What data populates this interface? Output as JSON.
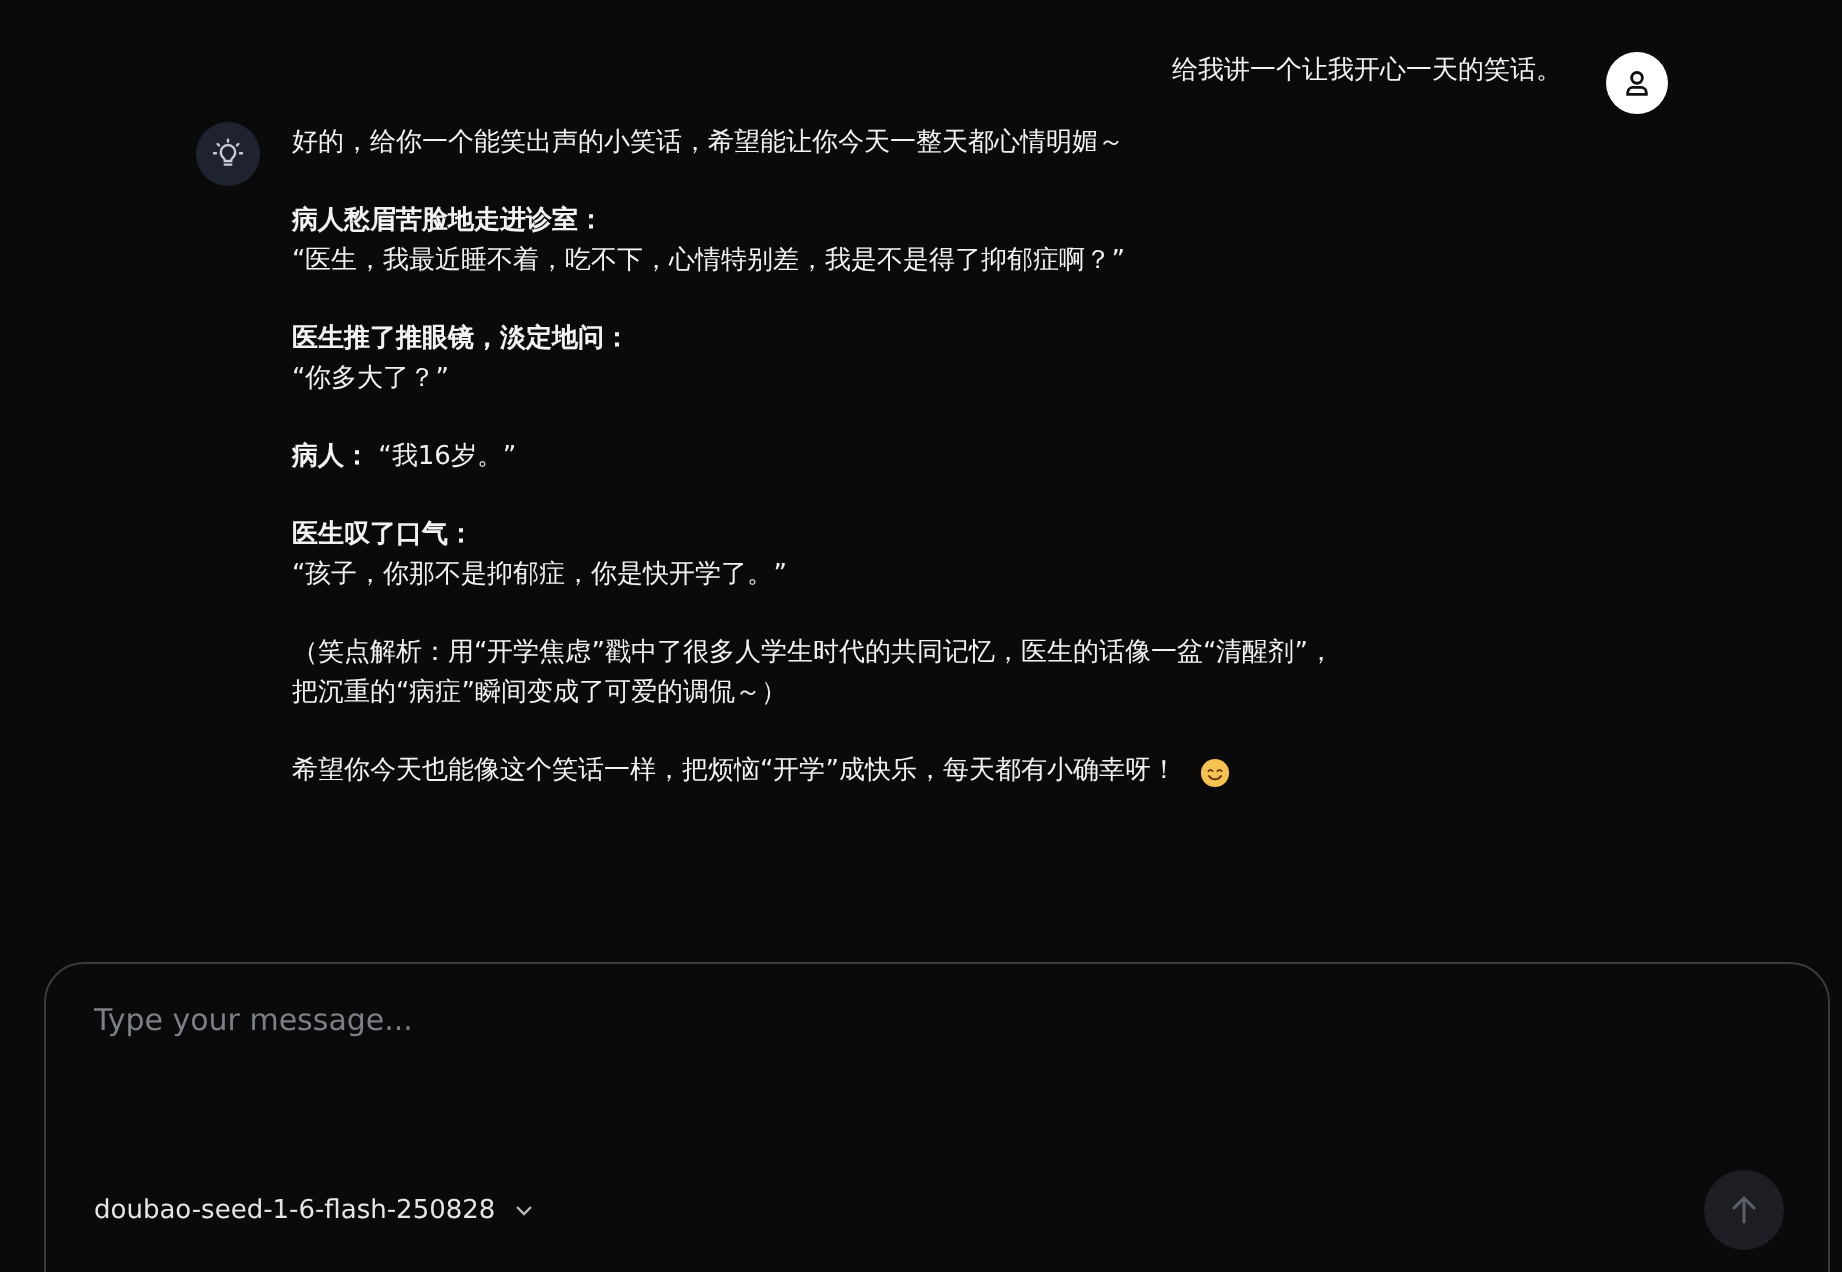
{
  "user_message": {
    "text": "给我讲一个让我开心一天的笑话。"
  },
  "assistant_message": {
    "paragraphs": [
      {
        "lines": [
          {
            "text": "好的，给你一个能笑出声的小笑话，希望能让你今天一整天都心情明媚～",
            "bold": false
          }
        ]
      },
      {
        "lines": [
          {
            "text": "病人愁眉苦脸地走进诊室：",
            "bold": true
          },
          {
            "text": "“医生，我最近睡不着，吃不下，心情特别差，我是不是得了抑郁症啊？”",
            "bold": false
          }
        ]
      },
      {
        "lines": [
          {
            "text": "医生推了推眼镜，淡定地问：",
            "bold": true
          },
          {
            "text": "“你多大了？”",
            "bold": false
          }
        ]
      },
      {
        "lines": [
          {
            "text": "**病人：** “我16岁。”",
            "bold": false
          }
        ]
      },
      {
        "lines": [
          {
            "text": "医生叹了口气：",
            "bold": true
          },
          {
            "text": "“孩子，你那不是抑郁症，你是快开学了。”",
            "bold": false
          }
        ]
      },
      {
        "lines": [
          {
            "text": "（笑点解析：用“开学焦虑”戳中了很多人学生时代的共同记忆，医生的话像一盆“清醒剂”，把沉重的“病症”瞬间变成了可爱的调侃～）",
            "bold": false
          }
        ]
      },
      {
        "lines": [
          {
            "text": "希望你今天也能像这个笑话一样，把烦恼“开学”成快乐，每天都有小确幸呀！",
            "bold": false
          }
        ],
        "trailing_smiley": true
      }
    ]
  },
  "composer": {
    "placeholder": "Type your message...",
    "model": "doubao-seed-1-6-flash-250828",
    "send_disabled": true
  }
}
